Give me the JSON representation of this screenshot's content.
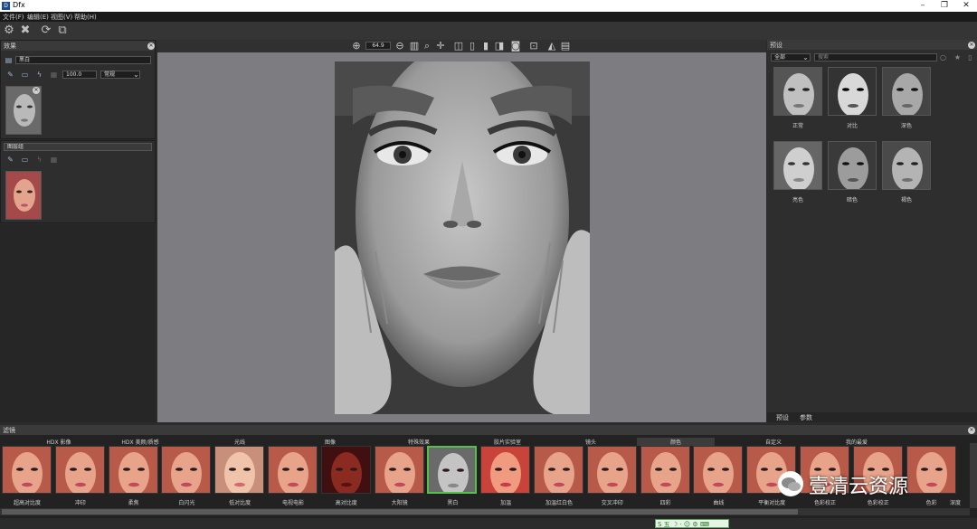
{
  "window": {
    "title": "Dfx",
    "app_icon": "dfx-logo-icon"
  },
  "menu": [
    "文件(F)",
    "编辑(E)",
    "视图(V)",
    "帮助(H)"
  ],
  "toolbar": {
    "icons": [
      "gear-icon",
      "close-icon",
      "refresh-icon",
      "compare-icon"
    ]
  },
  "effects_panel": {
    "title": "效果",
    "layer_name": "黑白",
    "opacity": "100.0",
    "blend_mode": "常规"
  },
  "layers_panel": {
    "title": "图层组"
  },
  "canvas": {
    "zoom": "64.9"
  },
  "presets_panel": {
    "title": "预设",
    "filter_select": "全部",
    "search_placeholder": "搜索",
    "items": [
      "正常",
      "对比",
      "深色",
      "亮色",
      "暗色",
      "褐色"
    ],
    "tabs": [
      "预设",
      "参数"
    ]
  },
  "filters_panel": {
    "title": "滤镜",
    "categories": [
      "HDX 影像",
      "HDX 美颜/质感",
      "光线",
      "图像",
      "特殊效果",
      "胶片实验室",
      "镜头",
      "颜色",
      "自定义",
      "我的最爱"
    ],
    "items": [
      {
        "label": "超高对比度",
        "tone": "warm"
      },
      {
        "label": "冲印",
        "tone": "warm"
      },
      {
        "label": "柔焦",
        "tone": "warm"
      },
      {
        "label": "白闪光",
        "tone": "warm"
      },
      {
        "label": "低对比度",
        "tone": "light"
      },
      {
        "label": "电视电影",
        "tone": "warm"
      },
      {
        "label": "高对比度",
        "tone": "dark"
      },
      {
        "label": "大阳镜",
        "tone": "warm"
      },
      {
        "label": "黑白",
        "tone": "bw"
      },
      {
        "label": "加温",
        "tone": "red"
      },
      {
        "label": "加温红白色",
        "tone": "warm"
      },
      {
        "label": "交叉冲印",
        "tone": "warm"
      },
      {
        "label": "四彩",
        "tone": "warm"
      },
      {
        "label": "曲线",
        "tone": "warm"
      },
      {
        "label": "平衡对比度",
        "tone": "warm"
      },
      {
        "label": "色彩校正",
        "tone": "warm"
      },
      {
        "label": "色彩校正",
        "tone": "warm"
      },
      {
        "label": "色彩",
        "tone": "warm"
      }
    ],
    "selected_index": 8,
    "trailing_label": "深度"
  },
  "watermark": {
    "text": "壹清云资源"
  },
  "colors": {
    "selected_border": "#52c24a",
    "canvas_bg": "#7d7c80"
  }
}
